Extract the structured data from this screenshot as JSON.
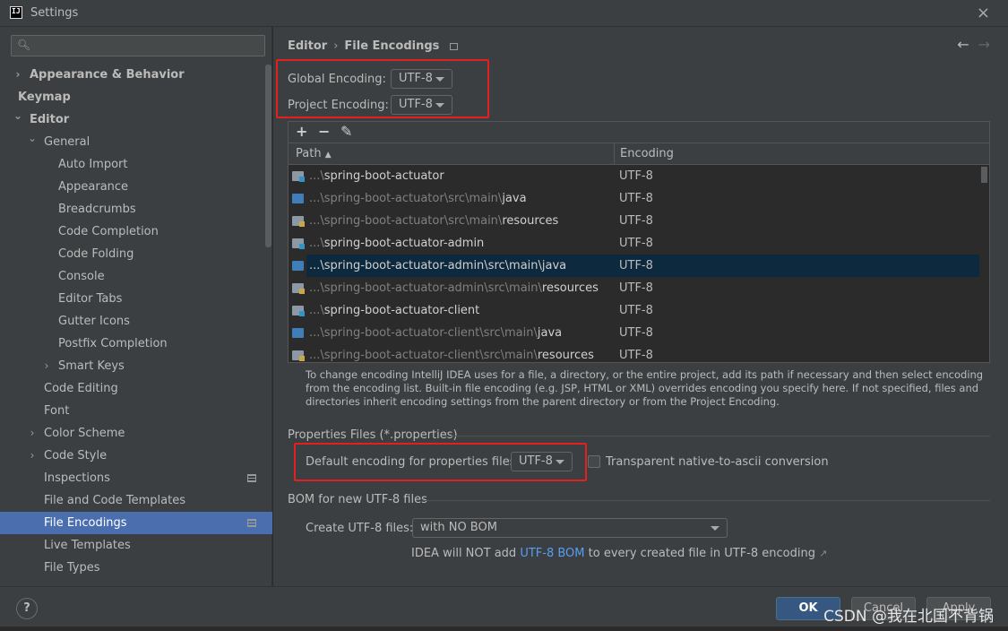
{
  "window": {
    "title": "Settings",
    "app_icon": "intellij-icon",
    "close": "×"
  },
  "sidebar": {
    "search": {
      "placeholder": ""
    },
    "items": [
      {
        "label": "Appearance & Behavior",
        "level": 0,
        "bold": true,
        "expand": "collapsed"
      },
      {
        "label": "Keymap",
        "level": 0,
        "bold": true,
        "expand": "none"
      },
      {
        "label": "Editor",
        "level": 0,
        "bold": true,
        "expand": "expanded"
      },
      {
        "label": "General",
        "level": 1,
        "bold": false,
        "expand": "expanded"
      },
      {
        "label": "Auto Import",
        "level": 2,
        "bold": false,
        "expand": "none"
      },
      {
        "label": "Appearance",
        "level": 2,
        "bold": false,
        "expand": "none"
      },
      {
        "label": "Breadcrumbs",
        "level": 2,
        "bold": false,
        "expand": "none"
      },
      {
        "label": "Code Completion",
        "level": 2,
        "bold": false,
        "expand": "none"
      },
      {
        "label": "Code Folding",
        "level": 2,
        "bold": false,
        "expand": "none"
      },
      {
        "label": "Console",
        "level": 2,
        "bold": false,
        "expand": "none"
      },
      {
        "label": "Editor Tabs",
        "level": 2,
        "bold": false,
        "expand": "none"
      },
      {
        "label": "Gutter Icons",
        "level": 2,
        "bold": false,
        "expand": "none"
      },
      {
        "label": "Postfix Completion",
        "level": 2,
        "bold": false,
        "expand": "none"
      },
      {
        "label": "Smart Keys",
        "level": 2,
        "bold": false,
        "expand": "collapsed"
      },
      {
        "label": "Code Editing",
        "level": 1,
        "bold": false,
        "expand": "none"
      },
      {
        "label": "Font",
        "level": 1,
        "bold": false,
        "expand": "none"
      },
      {
        "label": "Color Scheme",
        "level": 1,
        "bold": false,
        "expand": "collapsed"
      },
      {
        "label": "Code Style",
        "level": 1,
        "bold": false,
        "expand": "collapsed"
      },
      {
        "label": "Inspections",
        "level": 1,
        "bold": false,
        "expand": "none",
        "page_icon": true
      },
      {
        "label": "File and Code Templates",
        "level": 1,
        "bold": false,
        "expand": "none"
      },
      {
        "label": "File Encodings",
        "level": 1,
        "bold": false,
        "expand": "none",
        "page_icon": true,
        "selected": true
      },
      {
        "label": "Live Templates",
        "level": 1,
        "bold": false,
        "expand": "none"
      },
      {
        "label": "File Types",
        "level": 1,
        "bold": false,
        "expand": "none"
      }
    ]
  },
  "header": {
    "crumb_parent": "Editor",
    "crumb_sep": "›",
    "crumb_current": "File Encodings",
    "back": "←",
    "forward": "→"
  },
  "global_encoding": {
    "label": "Global Encoding:",
    "value": "UTF-8"
  },
  "project_encoding": {
    "label": "Project Encoding:",
    "value": "UTF-8"
  },
  "table": {
    "toolbar": {
      "add": "+",
      "remove": "−",
      "edit": "✎"
    },
    "headers": {
      "path": "Path",
      "sort": "▲",
      "encoding": "Encoding"
    },
    "rows": [
      {
        "prefix": "...\\",
        "dim": "",
        "bright": "spring-boot-actuator",
        "encoding": "UTF-8",
        "folder": "module",
        "selected": false
      },
      {
        "prefix": "...\\",
        "dim": "spring-boot-actuator\\src\\main\\",
        "bright": "java",
        "encoding": "UTF-8",
        "folder": "src",
        "selected": false
      },
      {
        "prefix": "...\\",
        "dim": "spring-boot-actuator\\src\\main\\",
        "bright": "resources",
        "encoding": "UTF-8",
        "folder": "res",
        "selected": false
      },
      {
        "prefix": "...\\",
        "dim": "",
        "bright": "spring-boot-actuator-admin",
        "encoding": "UTF-8",
        "folder": "module",
        "selected": false
      },
      {
        "prefix": "...\\",
        "dim": "",
        "bright": "spring-boot-actuator-admin\\src\\main\\java",
        "encoding": "UTF-8",
        "folder": "src",
        "selected": true
      },
      {
        "prefix": "...\\",
        "dim": "spring-boot-actuator-admin\\src\\main\\",
        "bright": "resources",
        "encoding": "UTF-8",
        "folder": "res",
        "selected": false
      },
      {
        "prefix": "...\\",
        "dim": "",
        "bright": "spring-boot-actuator-client",
        "encoding": "UTF-8",
        "folder": "module",
        "selected": false
      },
      {
        "prefix": "...\\",
        "dim": "spring-boot-actuator-client\\src\\main\\",
        "bright": "java",
        "encoding": "UTF-8",
        "folder": "src",
        "selected": false
      },
      {
        "prefix": "...\\",
        "dim": "spring-boot-actuator-client\\src\\main\\",
        "bright": "resources",
        "encoding": "UTF-8",
        "folder": "res",
        "selected": false
      }
    ]
  },
  "help_text": "To change encoding IntelliJ IDEA uses for a file, a directory, or the entire project, add its path if necessary and then select encoding from the encoding list. Built-in file encoding (e.g. JSP, HTML or XML) overrides encoding you specify here. If not specified, files and directories inherit encoding settings from the parent directory or from the Project Encoding.",
  "properties": {
    "section": "Properties Files (*.properties)",
    "default_label": "Default encoding for properties files:",
    "default_value": "UTF-8",
    "transparent_label": "Transparent native-to-ascii conversion",
    "transparent_checked": false
  },
  "bom": {
    "section": "BOM for new UTF-8 files",
    "create_label": "Create UTF-8 files:",
    "create_value": "with NO BOM",
    "info_pre": "IDEA will NOT add ",
    "info_link": "UTF-8 BOM",
    "info_post": " to every created file in UTF-8 encoding",
    "info_arrow": "↗"
  },
  "footer": {
    "help": "?",
    "ok": "OK",
    "cancel": "Cancel",
    "apply": "Apply"
  },
  "watermark": "CSDN @我在北国不背锅",
  "colors": {
    "highlight_box": "#e32020",
    "selection": "#4b6eaf",
    "link": "#589df6"
  }
}
